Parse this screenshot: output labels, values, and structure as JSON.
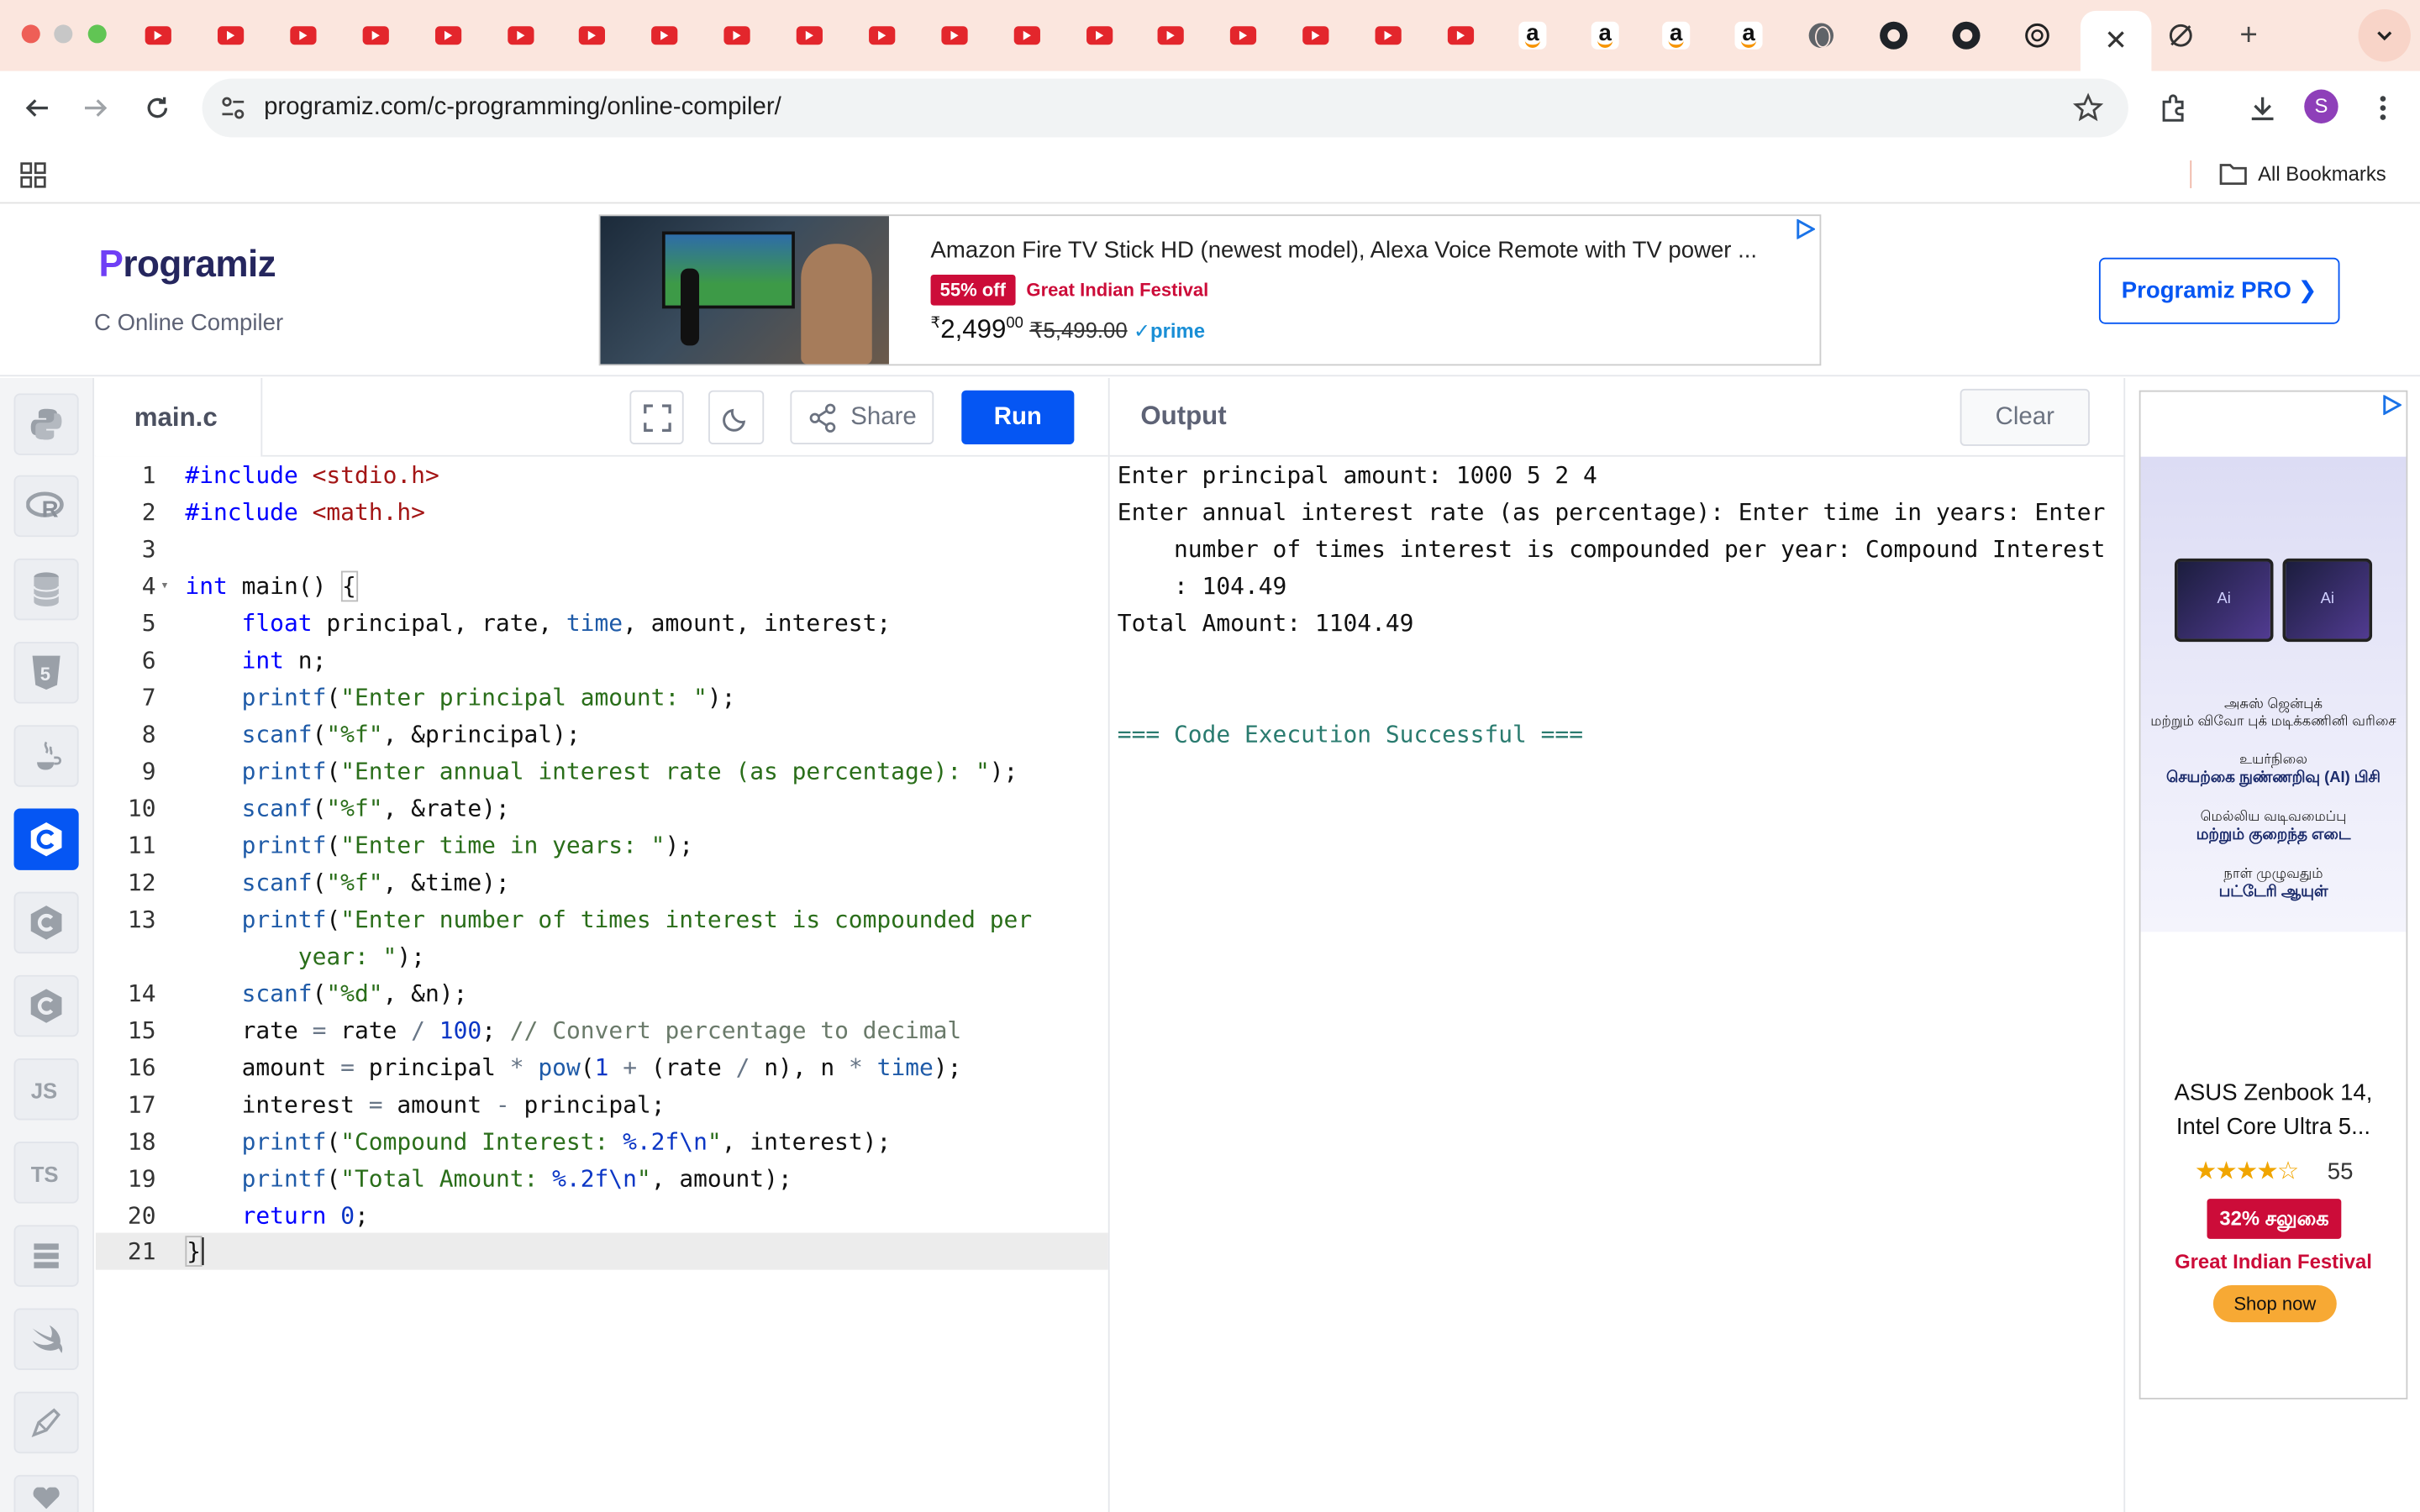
{
  "browser": {
    "url": "programiz.com/c-programming/online-compiler/",
    "avatar_initial": "S",
    "all_bookmarks": "All Bookmarks",
    "amazon_letter": "a",
    "close_glyph": "✕",
    "new_tab_glyph": "+"
  },
  "colors": {
    "accent": "#0556f3",
    "tab_strip": "#fbe6de",
    "deal_red": "#cc0c39"
  },
  "header": {
    "logo_first": "P",
    "logo_rest": "rogramiz",
    "subtitle": "C Online Compiler",
    "pro_button": "Programiz PRO ❯"
  },
  "top_ad": {
    "title": "Amazon Fire TV Stick HD (newest model), Alexa Voice Remote with TV power ...",
    "badge": "55% off",
    "festival": "Great Indian Festival",
    "price_symbol": "₹",
    "price": "2,499",
    "price_paise": "00",
    "mrp": "₹5,499.00",
    "prime": "✓prime"
  },
  "sidebar": {
    "languages": [
      {
        "name": "python",
        "glyph": "Py"
      },
      {
        "name": "r",
        "glyph": "R"
      },
      {
        "name": "sql",
        "glyph": "≡"
      },
      {
        "name": "html",
        "glyph": "5"
      },
      {
        "name": "java",
        "glyph": "☕"
      },
      {
        "name": "c",
        "glyph": "C",
        "active": true
      },
      {
        "name": "cpp",
        "glyph": "C"
      },
      {
        "name": "csharp",
        "glyph": "C"
      },
      {
        "name": "javascript",
        "glyph": "JS"
      },
      {
        "name": "typescript",
        "glyph": "TS"
      },
      {
        "name": "go",
        "glyph": "≣"
      },
      {
        "name": "swift",
        "glyph": "◢"
      },
      {
        "name": "rust",
        "glyph": "✎"
      }
    ]
  },
  "editor": {
    "filename": "main.c",
    "share_label": "Share",
    "run_label": "Run",
    "line_numbers": [
      "1",
      "2",
      "3",
      "4",
      "5",
      "6",
      "7",
      "8",
      "9",
      "10",
      "11",
      "12",
      "13",
      "",
      "14",
      "15",
      "16",
      "17",
      "18",
      "19",
      "20",
      "21"
    ]
  },
  "output": {
    "title": "Output",
    "clear_label": "Clear",
    "lines": [
      "Enter principal amount: 1000 5 2 4",
      "Enter annual interest rate (as percentage): Enter time in years: Enter",
      "    number of times interest is compounded per year: Compound Interest",
      "    : 104.49",
      "Total Amount: 1104.49",
      "",
      "",
      "=== Code Execution Successful ==="
    ]
  },
  "side_ad": {
    "laptop_a_label": "Ai",
    "laptop_b_label": "Ai",
    "tamil_line1": "அசுஸ் ஜென்புக்",
    "tamil_line2": "மற்றும் விவோ புக் மடிக்கணினி வரிசை",
    "tamil_line3": "உயர்நிலை",
    "tamil_line4": "செயற்கை நுண்ணறிவு (AI) பிசி",
    "tamil_line5": "மெல்லிய வடிவமைப்பு",
    "tamil_line6": "மற்றும் குறைந்த எடை",
    "tamil_line7": "நாள் முழுவதும்",
    "tamil_line8": "பட்டேரி ஆயுள்",
    "product_line1": "ASUS Zenbook 14,",
    "product_line2": "Intel Core Ultra 5...",
    "stars": "★★★★☆",
    "rating_count": "55",
    "discount": "32% சலுகை",
    "festival": "Great Indian Festival",
    "shop": "Shop now"
  }
}
